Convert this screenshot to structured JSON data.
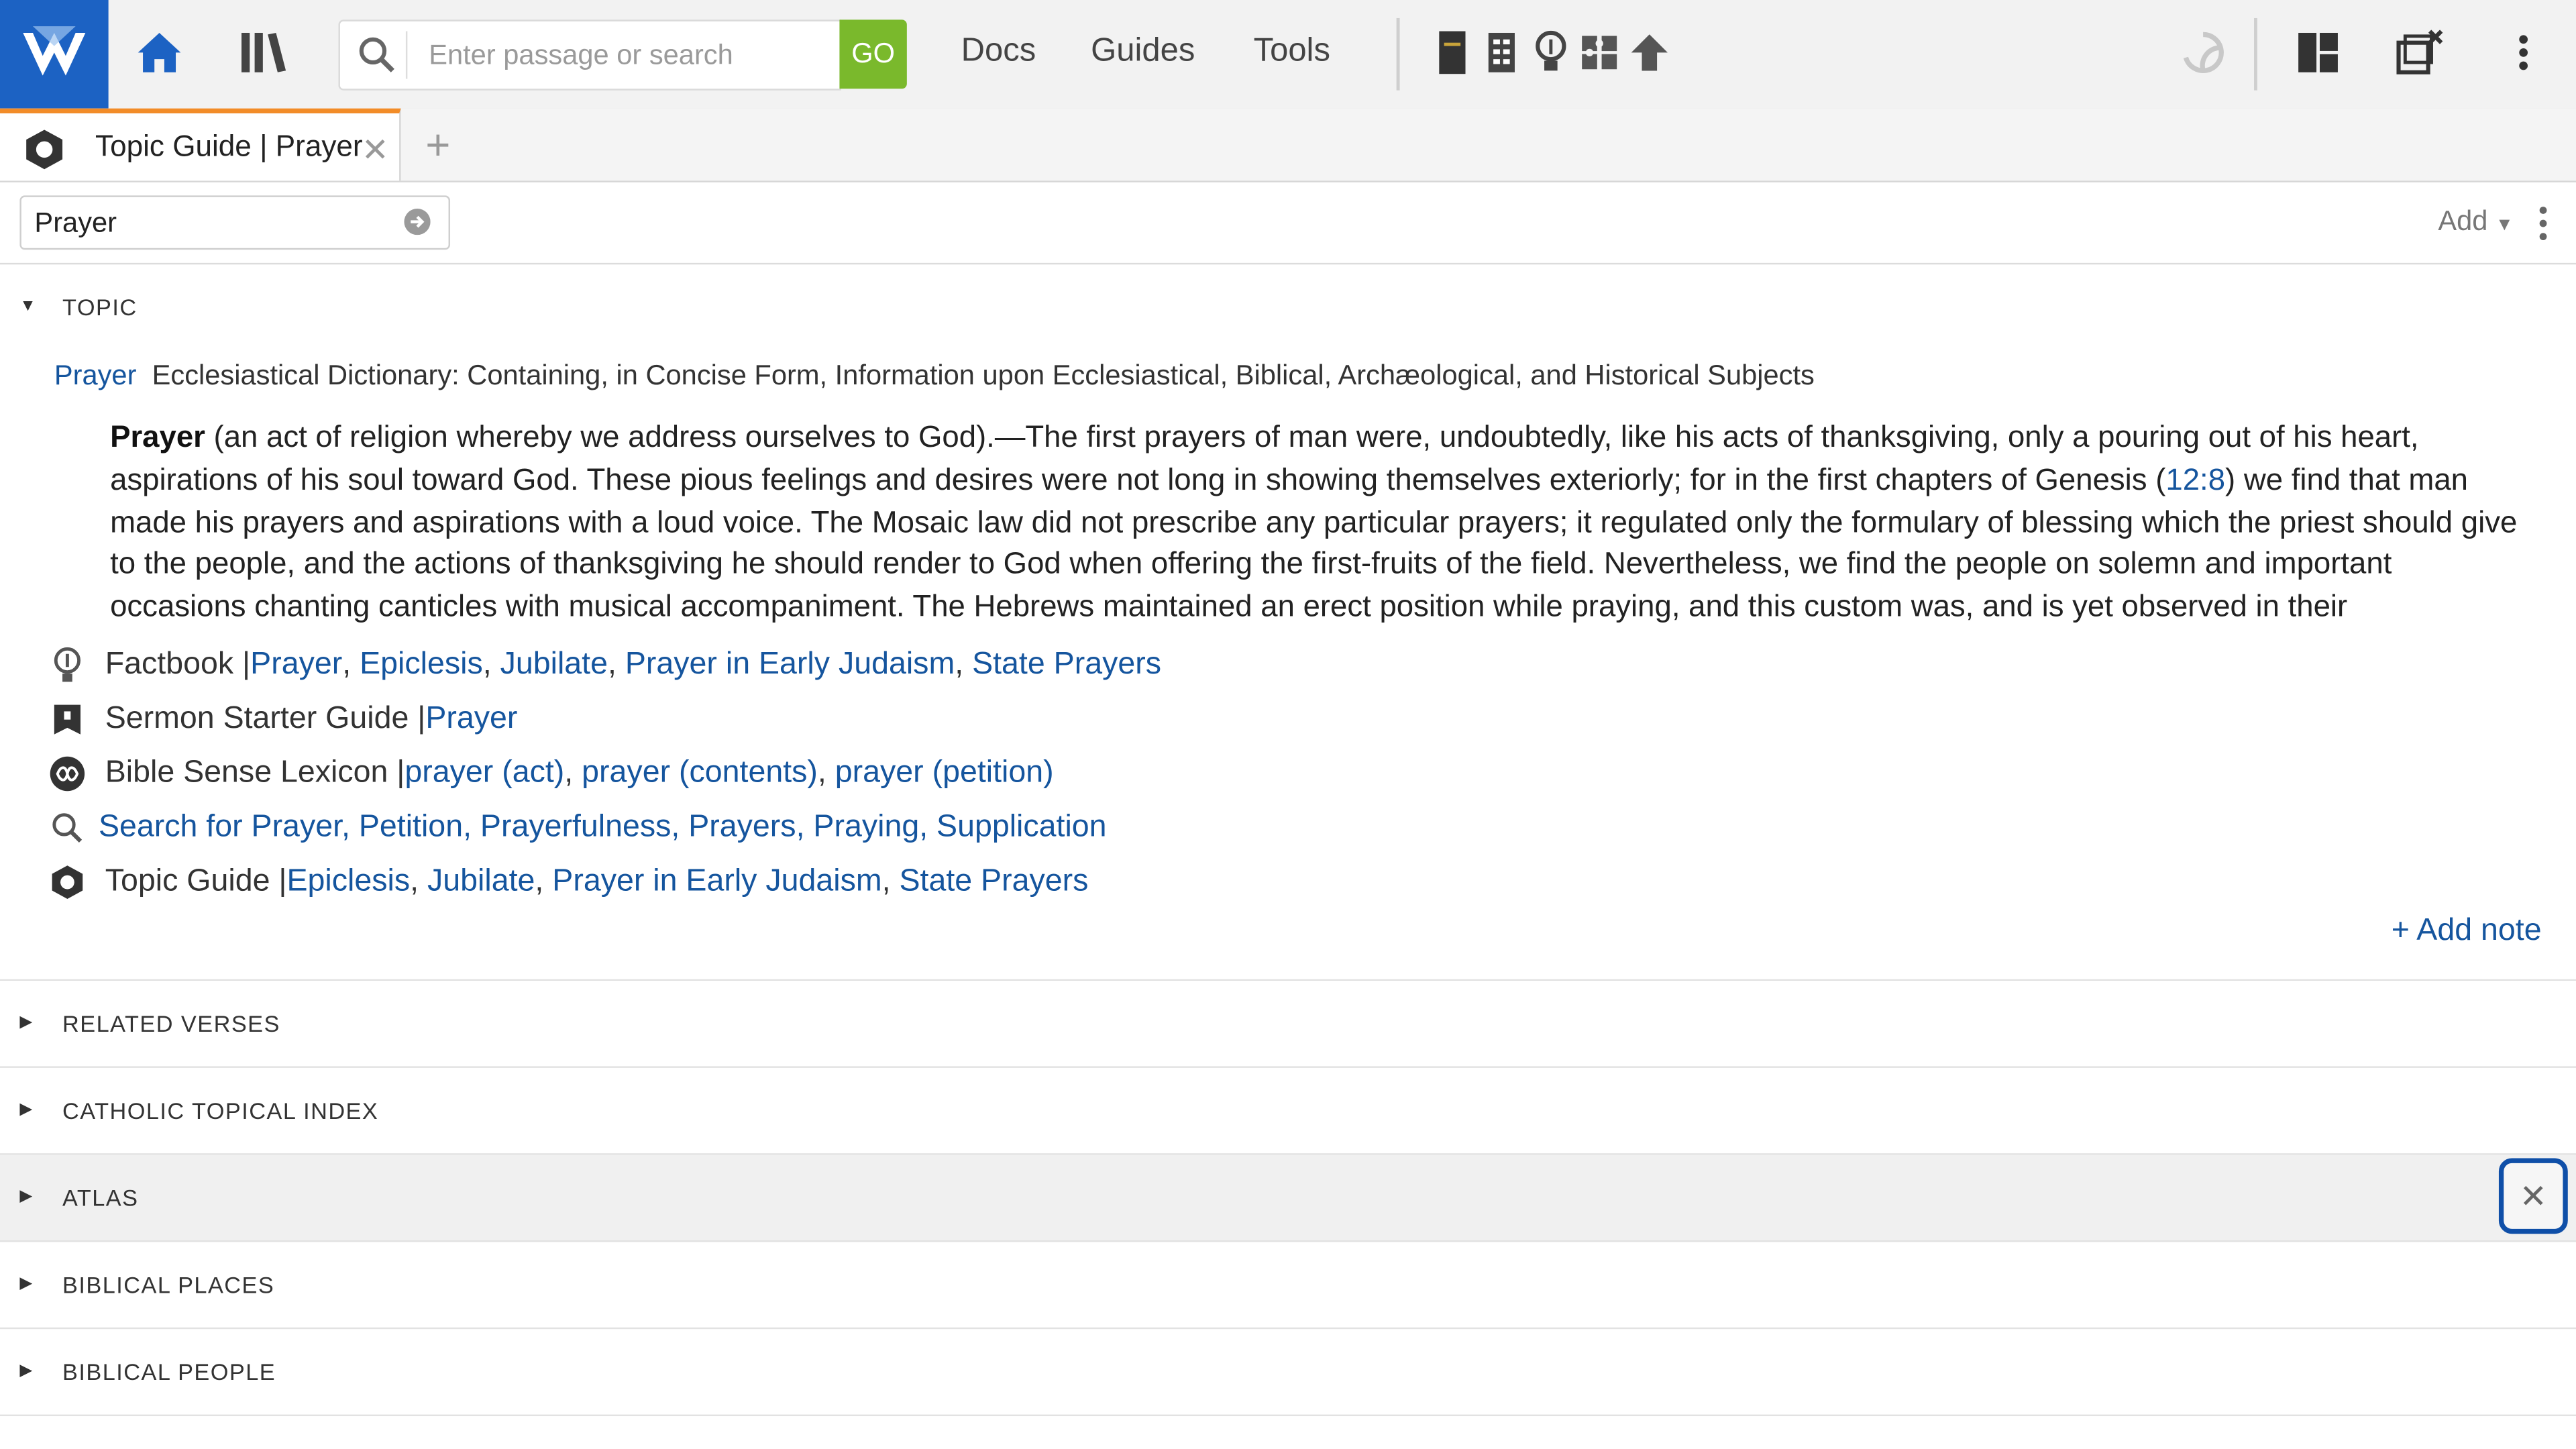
{
  "toolbar": {
    "search_placeholder": "Enter passage or search",
    "go_label": "GO",
    "menu": [
      "Docs",
      "Guides",
      "Tools"
    ]
  },
  "tab": {
    "title": "Topic Guide | Prayer",
    "close": "✕",
    "add": "+"
  },
  "panel": {
    "topic_value": "Prayer",
    "add_label": "Add"
  },
  "topic": {
    "section_title": "TOPIC",
    "headword": "Prayer",
    "source": "Ecclesiastical Dictionary: Containing, in Concise Form, Information upon Ecclesiastical, Biblical, Archæological, and Historical Subjects",
    "article_bold": "Prayer",
    "article_part1": " (an act of religion whereby we address ourselves to God).—The first prayers of man were, undoubtedly, like his acts of thanksgiving, only a pouring out of his heart, aspirations of his soul toward God. These pious feelings and desires were not long in showing themselves exteriorly; for in the first chapters of Genesis (",
    "article_ref": "12:8",
    "article_part2": ") we find that man made his prayers and aspirations with a loud voice. The Mosaic law did not prescribe any particular prayers; it regulated only the formulary of blessing which the priest should give to the people, and the actions of thanksgiving he should render to God when offering the first-fruits of the field. Nevertheless, we find the people on solemn and important occasions chanting canticles with musical accompaniment. The Hebrews maintained an erect position while praying, and this custom was, and is yet observed in their",
    "refs": {
      "factbook": {
        "label": "Factbook | ",
        "links": [
          "Prayer",
          "Epiclesis",
          "Jubilate",
          "Prayer in Early Judaism",
          "State Prayers"
        ]
      },
      "sermon": {
        "label": "Sermon Starter Guide | ",
        "links": [
          "Prayer"
        ]
      },
      "lexicon": {
        "label": "Bible Sense Lexicon | ",
        "links": [
          "prayer (act)",
          "prayer (contents)",
          "prayer (petition)"
        ]
      },
      "search": {
        "text": "Search for Prayer, Petition, Prayerfulness, Prayers, Praying, Supplication"
      },
      "topicguide": {
        "label": "Topic Guide | ",
        "links": [
          "Epiclesis",
          "Jubilate",
          "Prayer in Early Judaism",
          "State Prayers"
        ]
      }
    },
    "add_note": "+ Add note"
  },
  "sections": [
    "RELATED VERSES",
    "CATHOLIC TOPICAL INDEX",
    "ATLAS",
    "BIBLICAL PLACES",
    "BIBLICAL PEOPLE"
  ],
  "close_glyph": "✕",
  "colors": {
    "brand": "#1c62c3",
    "go": "#7ab92c",
    "tab_accent": "#f28c28",
    "link": "#15559e",
    "focus": "#0f4fa8"
  }
}
